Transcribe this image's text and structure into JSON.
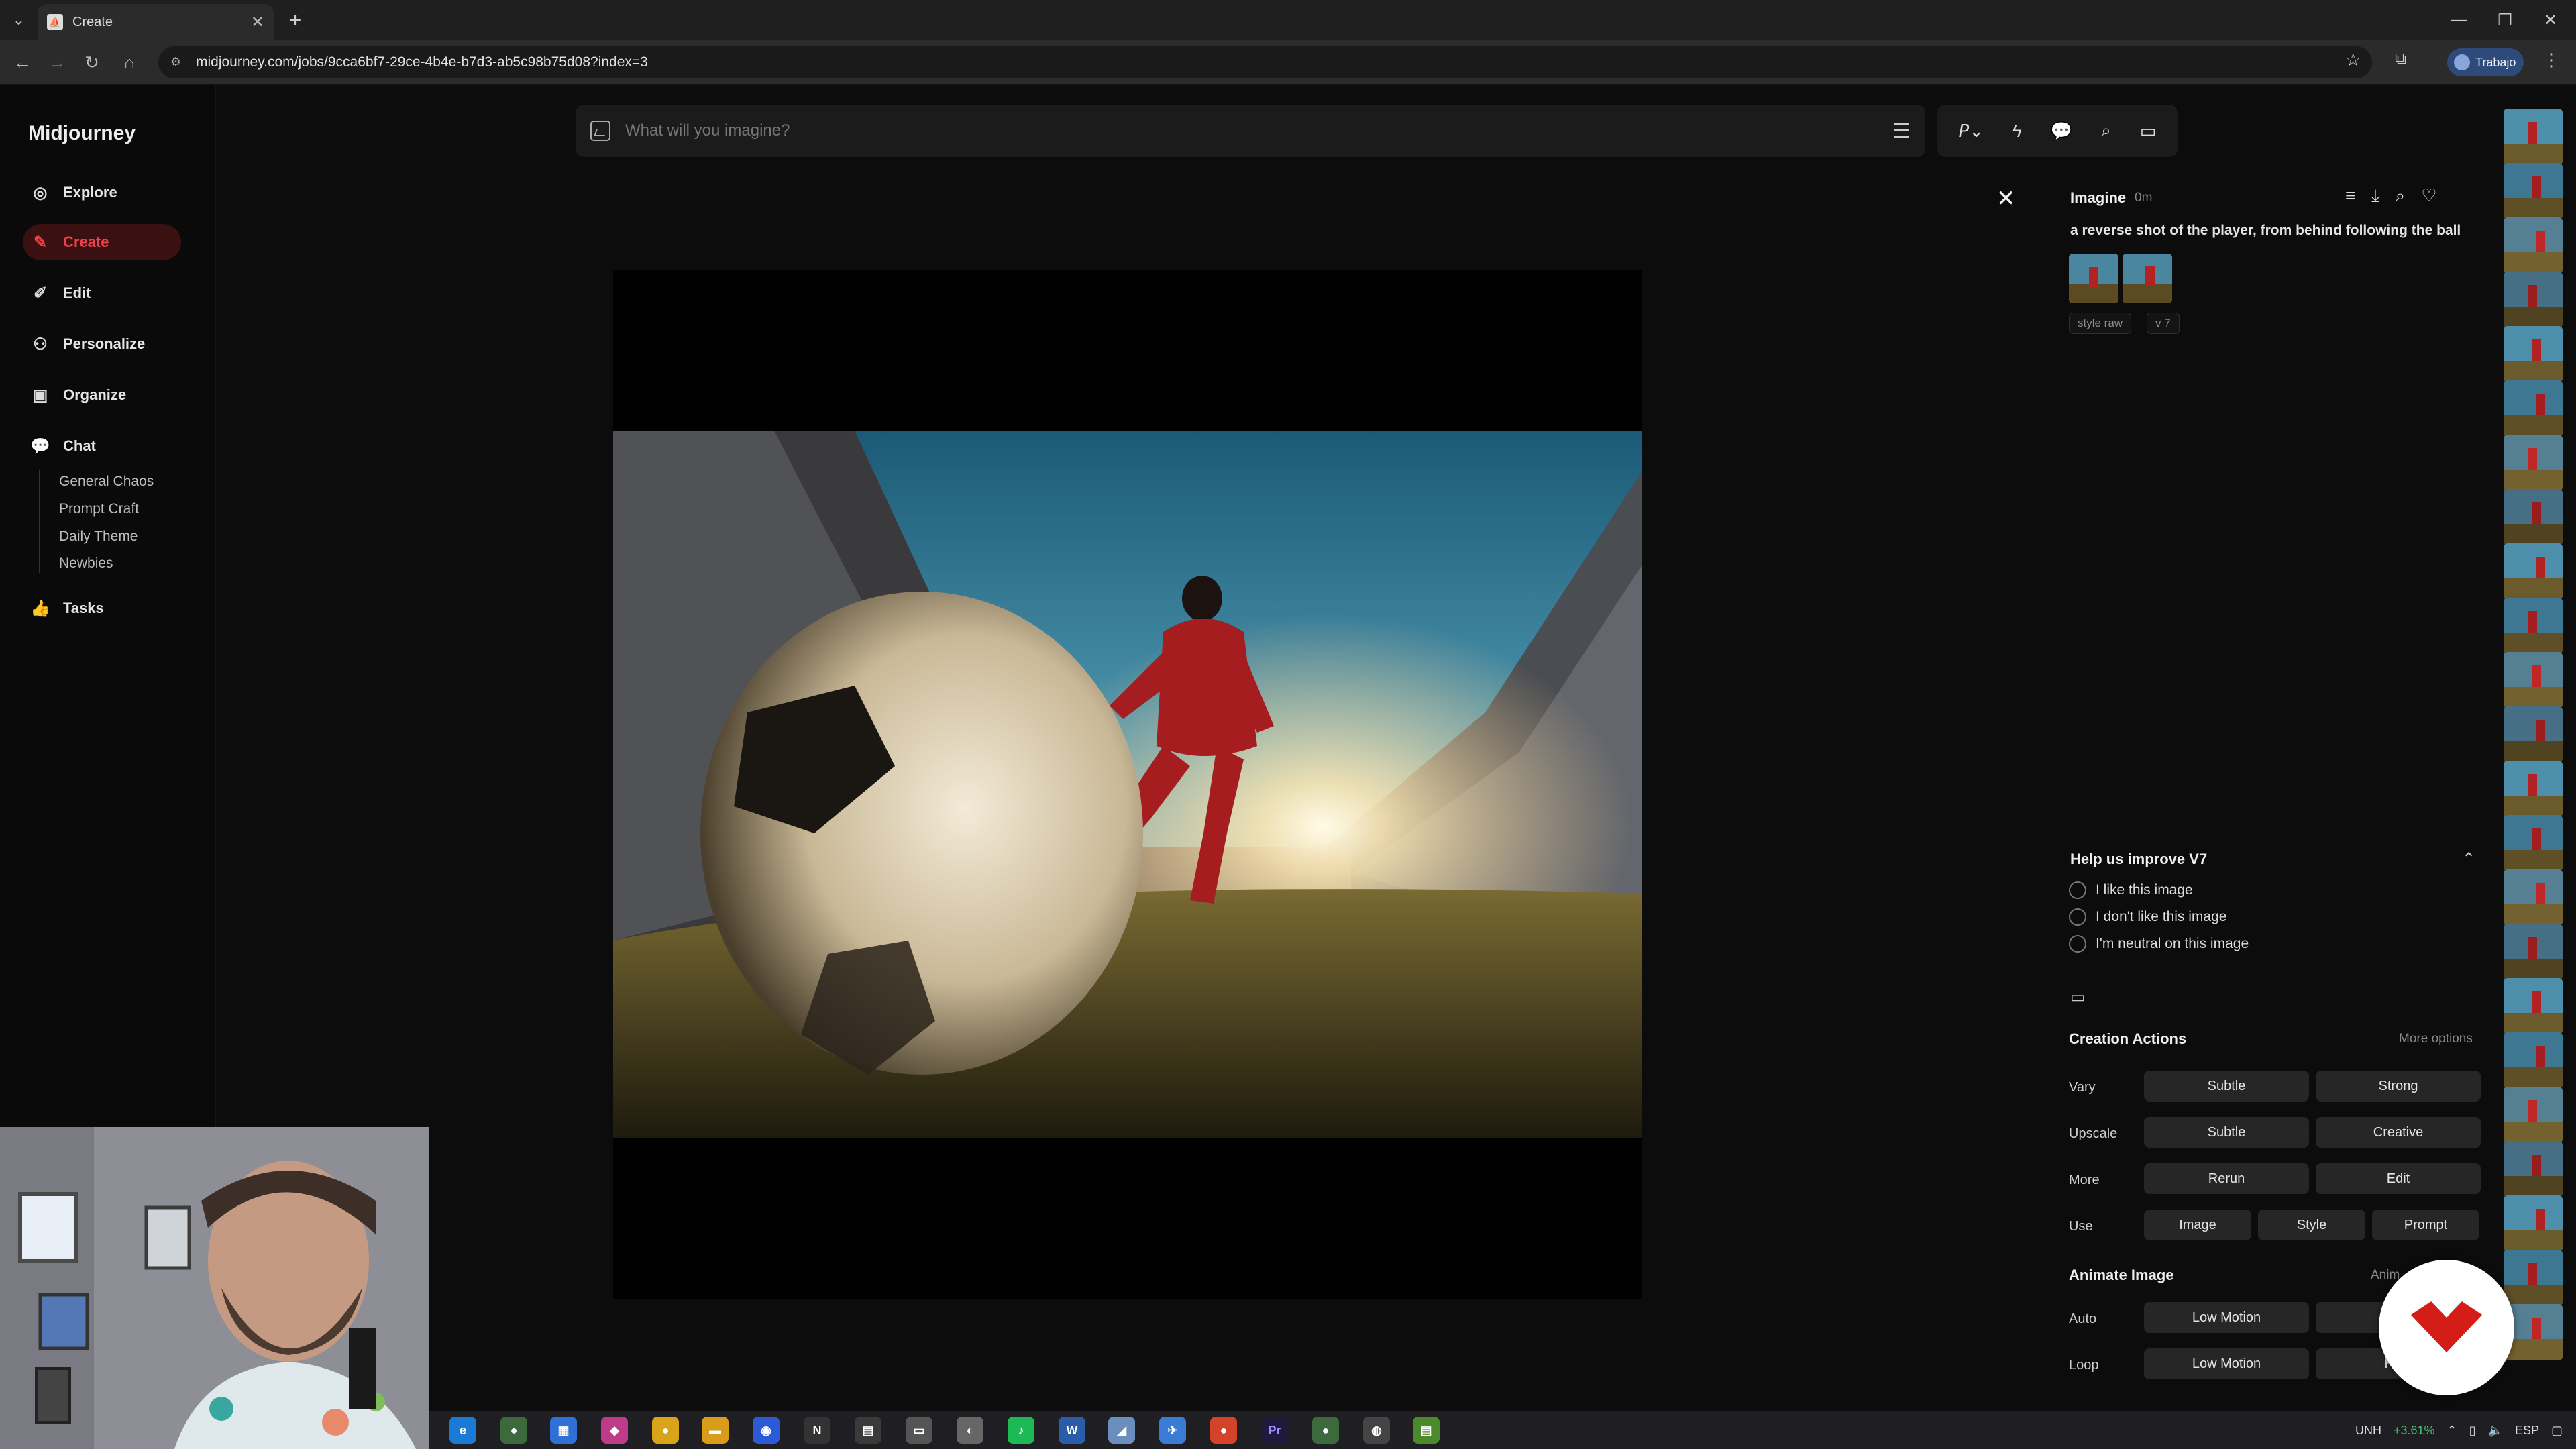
{
  "browser": {
    "tab_title": "Create",
    "url": "midjourney.com/jobs/9cca6bf7-29ce-4b4e-b7d3-ab5c98b75d08?index=3",
    "profile_label": "Trabajo"
  },
  "sidebar": {
    "brand": "Midjourney",
    "items": [
      {
        "label": "Explore",
        "icon": "compass-icon"
      },
      {
        "label": "Create",
        "icon": "brush-icon"
      },
      {
        "label": "Edit",
        "icon": "pencil-icon"
      },
      {
        "label": "Personalize",
        "icon": "personalize-icon"
      },
      {
        "label": "Organize",
        "icon": "image-grid-icon"
      },
      {
        "label": "Chat",
        "icon": "chat-icon"
      }
    ],
    "chat_rooms": [
      "General Chaos",
      "Prompt Craft",
      "Daily Theme",
      "Newbies"
    ],
    "tasks": {
      "label": "Tasks",
      "icon": "thumbs-up-icon"
    }
  },
  "search": {
    "placeholder": "What will you imagine?"
  },
  "job": {
    "title": "Imagine",
    "time": "0m",
    "prompt": "a reverse shot of the player, from behind following the ball",
    "tags": [
      "style raw",
      "v 7"
    ]
  },
  "feedback": {
    "title": "Help us improve V7",
    "options": [
      "I like this image",
      "I don't like this image",
      "I'm neutral on this image"
    ]
  },
  "creation_actions": {
    "title": "Creation Actions",
    "more": "More options",
    "rows": [
      {
        "label": "Vary",
        "buttons": [
          "Subtle",
          "Strong"
        ]
      },
      {
        "label": "Upscale",
        "buttons": [
          "Subtle",
          "Creative"
        ]
      },
      {
        "label": "More",
        "buttons": [
          "Rerun",
          "Edit"
        ]
      },
      {
        "label": "Use",
        "buttons": [
          "Image",
          "Style",
          "Prompt"
        ]
      }
    ]
  },
  "animate": {
    "title": "Animate Image",
    "title_cut": "Anim",
    "rows": [
      {
        "label": "Auto",
        "buttons": [
          "Low Motion",
          "Hig"
        ]
      },
      {
        "label": "Loop",
        "buttons": [
          "Low Motion",
          "High"
        ]
      }
    ]
  },
  "taskbar": {
    "ticker": "UNH",
    "change": "+3.61%",
    "lang": "ESP"
  }
}
